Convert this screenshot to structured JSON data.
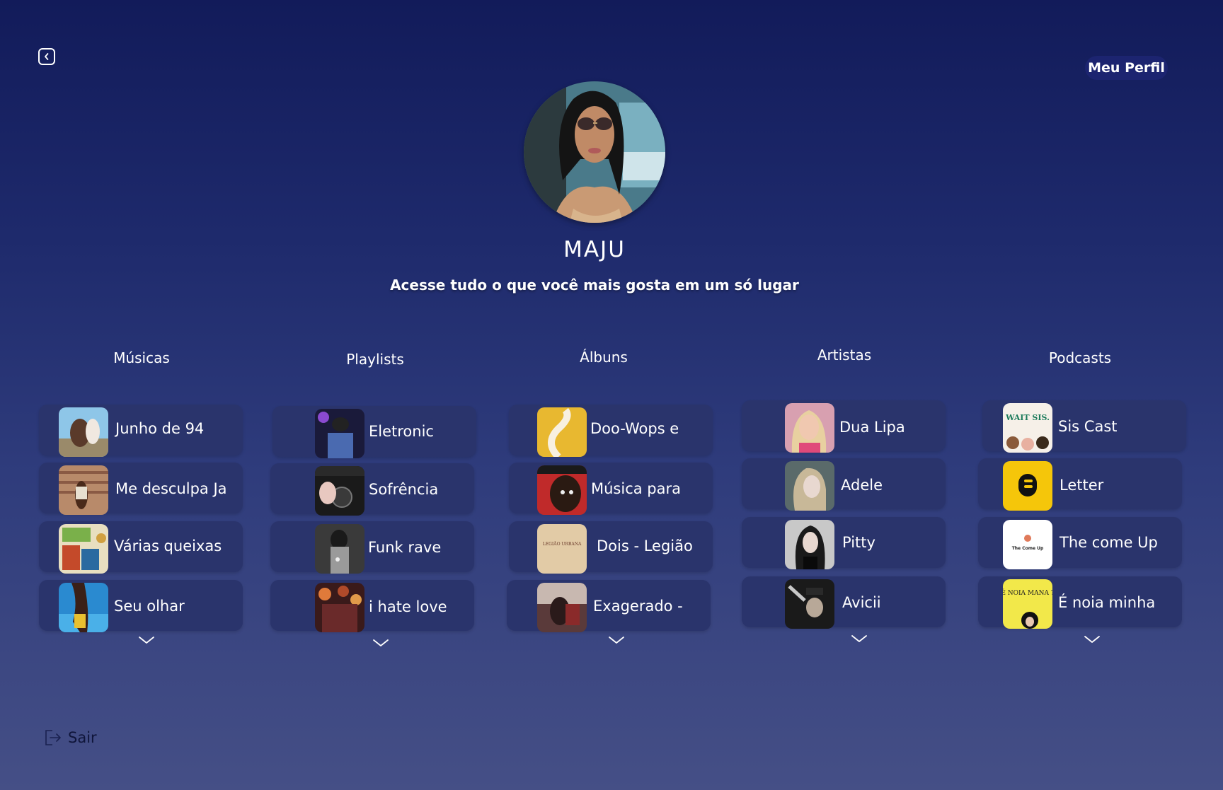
{
  "header": {
    "back_icon": "chevron-left-icon",
    "profile_button": "Meu Perfil"
  },
  "profile": {
    "username": "MAJU",
    "tagline": "Acesse tudo o que você mais gosta em um só lugar"
  },
  "columns": {
    "musicas": {
      "title": "Músicas",
      "items": [
        "Junho de 94",
        "Me desculpa Ja",
        "Várias queixas",
        "Seu olhar"
      ]
    },
    "playlists": {
      "title": "Playlists",
      "items": [
        "Eletronic",
        "Sofrência",
        "Funk rave",
        "i hate love"
      ]
    },
    "albuns": {
      "title": "Álbuns",
      "items": [
        "Doo-Wops e",
        "Música para",
        "Dois - Legião",
        "Exagerado -"
      ]
    },
    "artistas": {
      "title": "Artistas",
      "items": [
        "Dua Lipa",
        "Adele",
        "Pitty",
        "Avicii"
      ]
    },
    "podcasts": {
      "title": "Podcasts",
      "items": [
        "Sis Cast",
        "Letter",
        "The come Up",
        "É noia minha"
      ]
    }
  },
  "thumb_text": {
    "waitsis": "WAIT SIS.",
    "legiao": "LEGIÃO URBANA",
    "comeup": "The Come Up",
    "noia": "É NOIA MANA ?"
  },
  "footer": {
    "logout_label": "Sair",
    "logout_icon": "logout-icon"
  },
  "colors": {
    "background_top": "#121b5a",
    "background_bottom": "#454f86",
    "card": "#2a346c",
    "profile_button": "#1c2470"
  }
}
